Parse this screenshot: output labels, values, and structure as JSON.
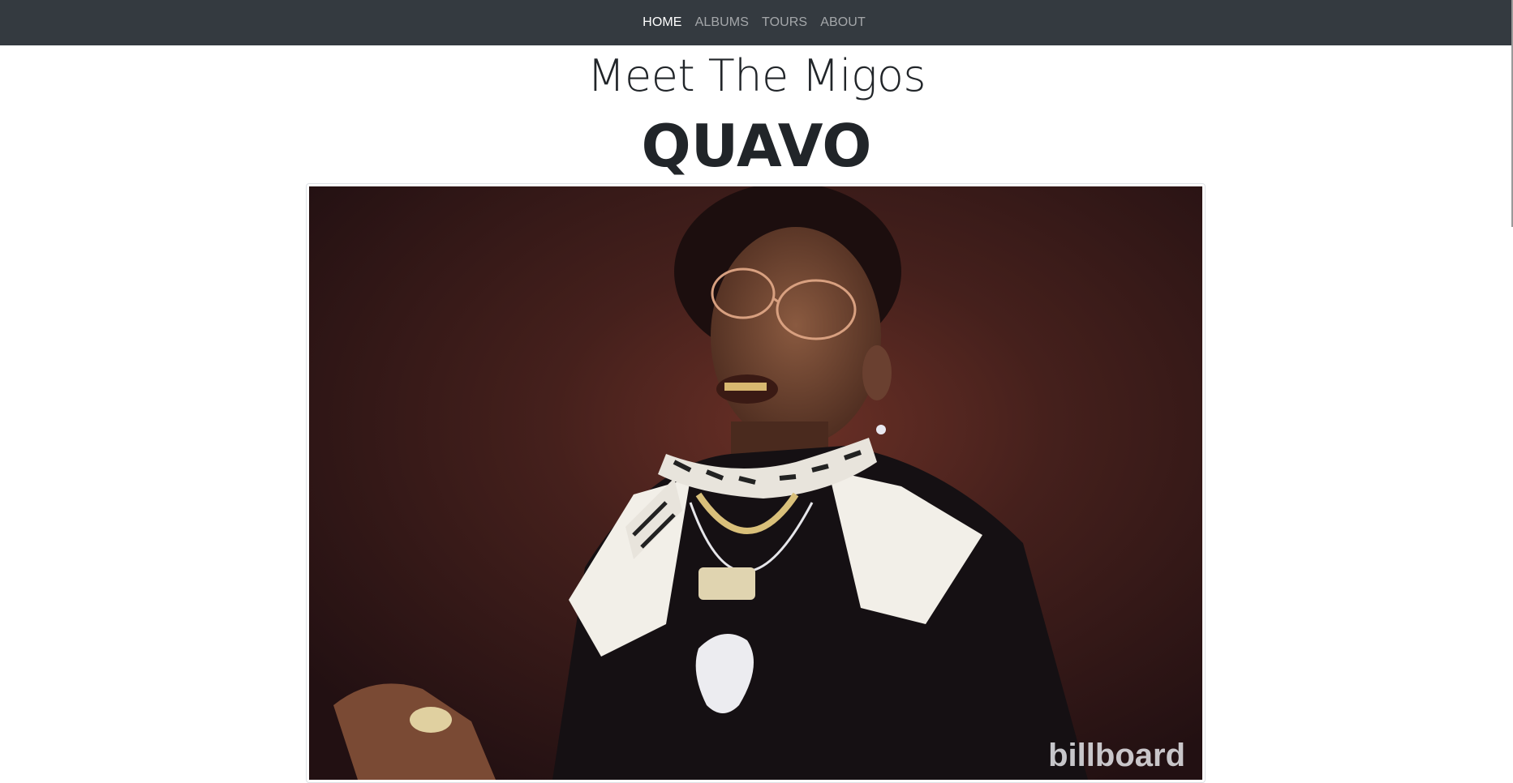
{
  "nav": {
    "items": [
      {
        "label": "HOME",
        "active": true
      },
      {
        "label": "ALBUMS",
        "active": false
      },
      {
        "label": "TOURS",
        "active": false
      },
      {
        "label": "ABOUT",
        "active": false
      }
    ]
  },
  "main": {
    "heading": "Meet The Migos",
    "member_name": "QUAVO",
    "photo": {
      "watermark": "billboard"
    }
  },
  "colors": {
    "navbar_bg": "#343a40",
    "nav_active": "#ffffff",
    "nav_inactive": "rgba(255,255,255,0.55)",
    "text_dark": "#212529",
    "photo_bg": "#3f1c1a"
  }
}
